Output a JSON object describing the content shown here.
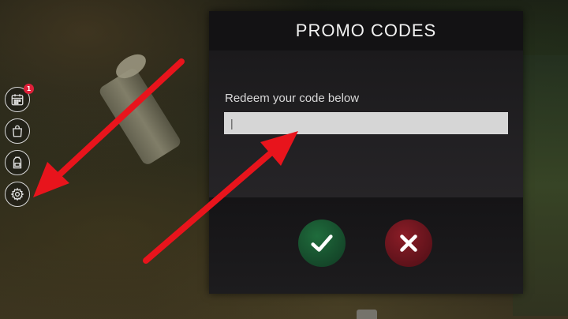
{
  "panel": {
    "title": "PROMO CODES",
    "label": "Redeem your code below",
    "input_value": "|",
    "confirm_icon": "checkmark-icon",
    "cancel_icon": "x-icon"
  },
  "sidebar": {
    "items": [
      {
        "name": "calendar-icon",
        "badge": "1"
      },
      {
        "name": "shopping-bag-icon"
      },
      {
        "name": "backpack-icon"
      },
      {
        "name": "gear-icon"
      }
    ]
  },
  "colors": {
    "arrow": "#e8141c",
    "confirm": "#1f6c3c",
    "cancel": "#8b1d27",
    "input_bg": "#d6d6d6"
  }
}
